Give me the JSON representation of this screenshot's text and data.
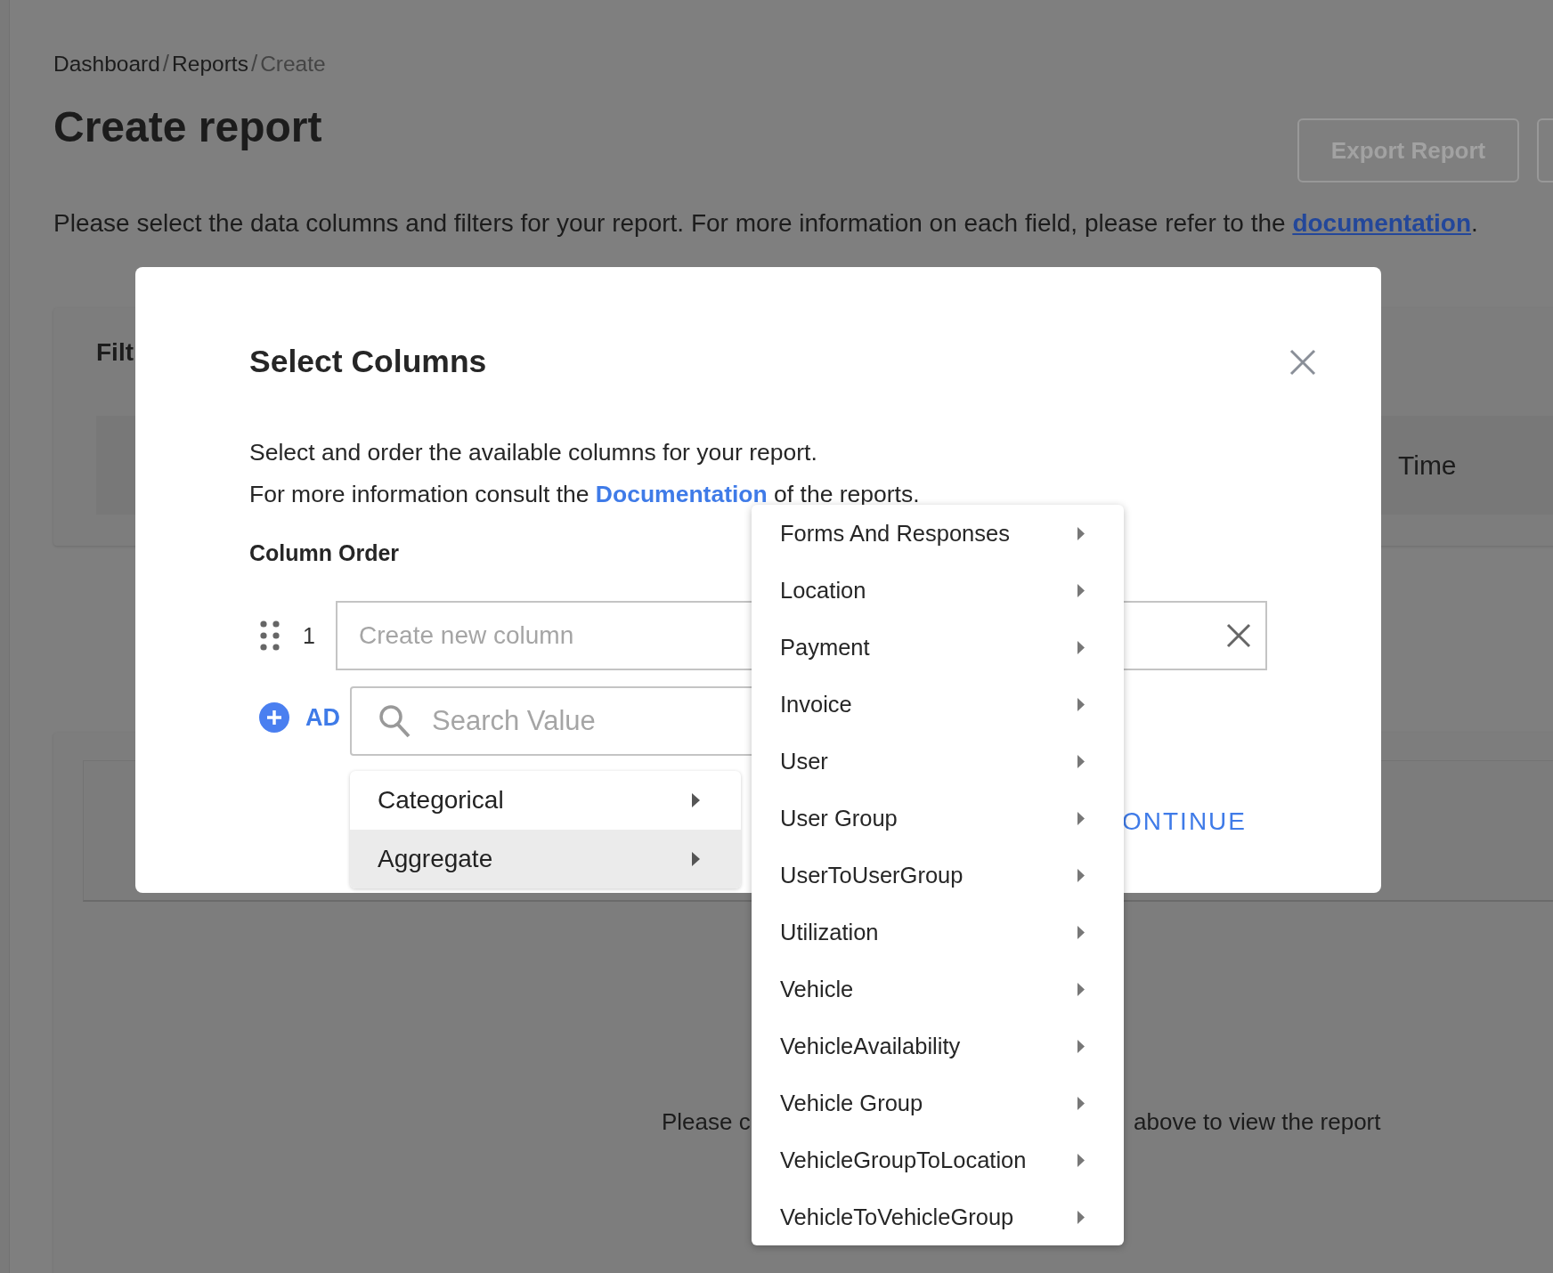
{
  "breadcrumb": [
    {
      "label": "Dashboard",
      "separator": "/",
      "current": false
    },
    {
      "label": "Reports",
      "separator": "/",
      "current": false
    },
    {
      "label": "Create",
      "current": true
    }
  ],
  "page_title": "Create report",
  "header_buttons": [
    "Export Report"
  ],
  "description": {
    "text": "Please select the data columns and filters for your report. For more information on each field, please refer to the ",
    "link": "documentation",
    "end": "."
  },
  "filters_card": {
    "title": "Filt",
    "row_label": "Time"
  },
  "report_card": {
    "message_start": "Please c",
    "message_end": "above to view the report"
  },
  "modal": {
    "title": "Select Columns",
    "intro": "Select and order the available columns for your report.",
    "info": {
      "text": "For more information consult the ",
      "link": "Documentation",
      "end": " of the reports."
    },
    "section_title": "Column Order",
    "columns": [
      {
        "index": "1",
        "placeholder": "Create new column"
      }
    ],
    "add_button": "AD",
    "continue_button": "ONTINUE"
  },
  "column_picker": {
    "search_placeholder": "Search Value",
    "groups": [
      {
        "label": "Categorical",
        "selected": false
      },
      {
        "label": "Aggregate",
        "selected": true
      }
    ],
    "submenu": [
      {
        "label": "Forms And Responses"
      },
      {
        "label": "Location"
      },
      {
        "label": "Payment"
      },
      {
        "label": "Invoice"
      },
      {
        "label": "User"
      },
      {
        "label": "User Group"
      },
      {
        "label": "UserToUserGroup"
      },
      {
        "label": "Utilization"
      },
      {
        "label": "Vehicle"
      },
      {
        "label": "VehicleAvailability"
      },
      {
        "label": "Vehicle Group"
      },
      {
        "label": "VehicleGroupToLocation"
      },
      {
        "label": "VehicleToVehicleGroup"
      }
    ]
  }
}
